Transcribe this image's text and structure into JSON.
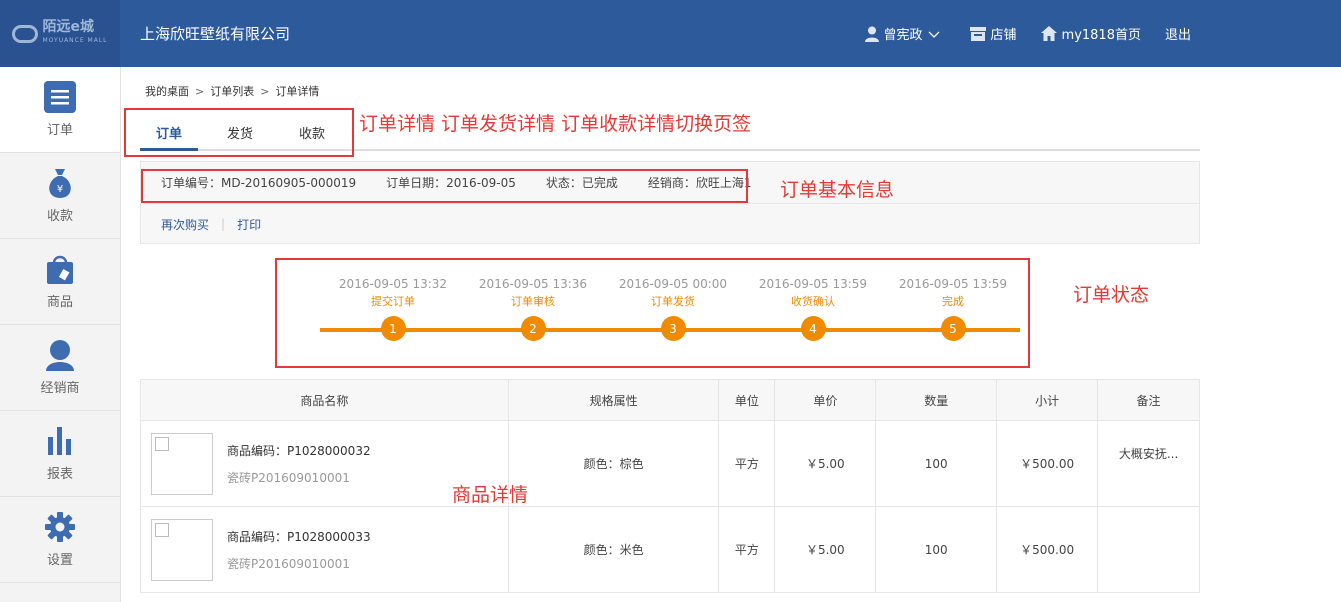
{
  "header": {
    "logo_text": "陌远e城",
    "logo_sub": "MOYUANCE MALL",
    "company": "上海欣旺壁纸有限公司",
    "nav": [
      {
        "label": "曾宪政",
        "icon": "user-icon"
      },
      {
        "label": "店铺",
        "icon": "store-icon"
      },
      {
        "label": "my1818首页",
        "icon": "home-icon"
      },
      {
        "label": "退出",
        "icon": ""
      }
    ]
  },
  "sidebar": {
    "items": [
      {
        "label": "订单",
        "icon": "list-icon",
        "active": true
      },
      {
        "label": "收款",
        "icon": "money-bag-icon"
      },
      {
        "label": "商品",
        "icon": "shopping-bag-icon"
      },
      {
        "label": "经销商",
        "icon": "person-icon"
      },
      {
        "label": "报表",
        "icon": "bar-chart-icon"
      },
      {
        "label": "设置",
        "icon": "gear-icon"
      }
    ]
  },
  "breadcrumb": [
    "我的桌面",
    "订单列表",
    "订单详情"
  ],
  "breadcrumb_sep": ">",
  "tabs": [
    "订单",
    "发货",
    "收款"
  ],
  "order_info": {
    "number": "订单编号：MD-20160905-000019",
    "date": "订单日期：2016-09-05",
    "status": "状态：已完成",
    "dealer": "经销商：欣旺上海1"
  },
  "actions": {
    "rebuy": "再次购买",
    "divider": "|",
    "print": "打印"
  },
  "steps": [
    {
      "time": "2016-09-05 13:32",
      "name": "提交订单",
      "num": "1"
    },
    {
      "time": "2016-09-05 13:36",
      "name": "订单审核",
      "num": "2"
    },
    {
      "time": "2016-09-05 00:00",
      "name": "订单发货",
      "num": "3"
    },
    {
      "time": "2016-09-05 13:59",
      "name": "收货确认",
      "num": "4"
    },
    {
      "time": "2016-09-05 13:59",
      "name": "完成",
      "num": "5"
    }
  ],
  "table": {
    "headers": [
      "商品名称",
      "规格属性",
      "单位",
      "单价",
      "数量",
      "小计",
      "备注"
    ],
    "rows": [
      {
        "code": "商品编码：P1028000032",
        "name": "瓷砖P201609010001",
        "spec": "颜色：棕色",
        "unit": "平方",
        "price": "￥5.00",
        "qty": "100",
        "subtotal": "￥500.00",
        "note": "大概安抚..."
      },
      {
        "code": "商品编码：P1028000033",
        "name": "瓷砖P201609010001",
        "spec": "颜色：米色",
        "unit": "平方",
        "price": "￥5.00",
        "qty": "100",
        "subtotal": "￥500.00",
        "note": ""
      }
    ]
  },
  "annotations": {
    "tabs": "订单详情 订单发货详情 订单收款详情切换页签",
    "info": "订单基本信息",
    "status": "订单状态",
    "products": "商品详情"
  },
  "colors": {
    "brand": "#2d5a9b",
    "accent": "#f08a00",
    "annotation": "#e53935"
  }
}
